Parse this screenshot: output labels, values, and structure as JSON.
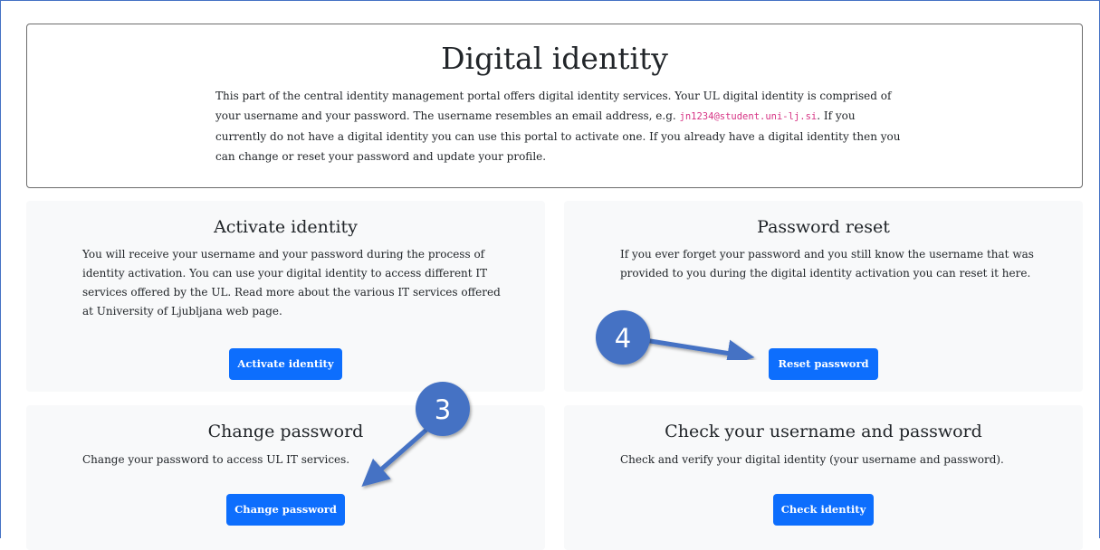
{
  "hero": {
    "title": "Digital identity",
    "text_before_email": "This part of the central identity management portal offers digital identity services. Your UL digital identity is comprised of your username and your password. The username resembles an email address, e.g. ",
    "example_email": "jn1234@student.uni-lj.si",
    "text_after_email": ". If you currently do not have a digital identity you can use this portal to activate one. If you already have a digital identity then you can change or reset your password and update your profile."
  },
  "cards": {
    "activate": {
      "title": "Activate identity",
      "text": "You will receive your username and your password during the process of identity activation. You can use your digital identity to access different IT services offered by the UL. Read more about the various IT services offered at University of Ljubljana web page.",
      "button_label": "Activate identity"
    },
    "reset": {
      "title": "Password reset",
      "text": "If you ever forget your password and you still know the username that was provided to you during the digital identity activation you can reset it here.",
      "button_label": "Reset password"
    },
    "change": {
      "title": "Change password",
      "text": "Change your password to access UL IT services.",
      "button_label": "Change password"
    },
    "check": {
      "title": "Check your username and password",
      "text": "Check and verify your digital identity (your username and password).",
      "button_label": "Check identity"
    }
  },
  "annotations": {
    "marker_3": "3",
    "marker_4": "4",
    "marker_color": "#4472c4",
    "button_color": "#0d6efd",
    "card_background": "#f8f9fa"
  }
}
